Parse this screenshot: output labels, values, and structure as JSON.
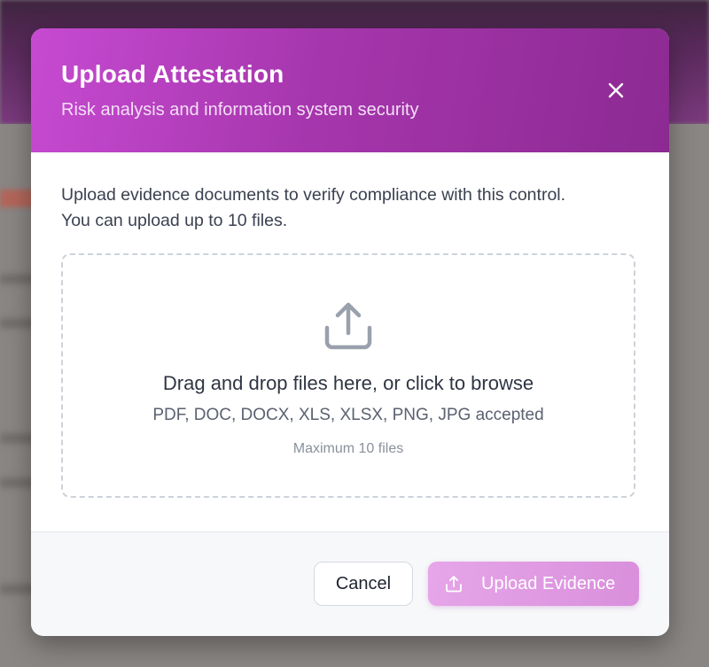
{
  "modal": {
    "title": "Upload Attestation",
    "subtitle": "Risk analysis and information system security",
    "close_icon": "close-icon",
    "intro_line1": "Upload evidence documents to verify compliance with this control.",
    "intro_line2": "You can upload up to 10 files."
  },
  "dropzone": {
    "icon": "upload-icon",
    "title": "Drag and drop files here, or click to browse",
    "formats": "PDF, DOC, DOCX, XLS, XLSX, PNG, JPG accepted",
    "max": "Maximum 10 files"
  },
  "footer": {
    "cancel_label": "Cancel",
    "upload_label": "Upload Evidence",
    "upload_icon": "upload-icon"
  },
  "colors": {
    "header_start": "#c64ad1",
    "header_end": "#8c2a92",
    "upload_button": "#e0a0e3"
  }
}
